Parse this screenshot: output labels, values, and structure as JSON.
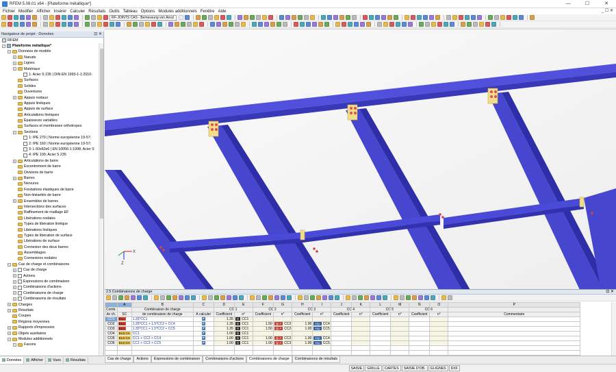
{
  "window": {
    "title": "RFEM 5.08.01 x64 - [Plateforme métallique*]",
    "min": "—",
    "max": "☐",
    "close": "✕"
  },
  "menu": {
    "items": [
      "Fichier",
      "Modifier",
      "Afficher",
      "Insérer",
      "Calculer",
      "Résultats",
      "Outils",
      "Tableau",
      "Options",
      "Modules additionnels",
      "Fenêtre",
      "Aide"
    ],
    "right": "_ ☐ ✕"
  },
  "toolbar": {
    "module_select": "RF-JOINTS CAS - Bemessung von Anscl",
    "arrow": "▾"
  },
  "navigator": {
    "title": "Navigateur de projet - Données",
    "controls": "⊡ ✕",
    "root": "RFEM",
    "tree": [
      {
        "label": "Plateforme métallique*",
        "level": 0,
        "exp": "−",
        "bold": true,
        "icon": "model"
      },
      {
        "label": "Données de modèle",
        "level": 1,
        "exp": "−",
        "icon": "folder"
      },
      {
        "label": "Nœuds",
        "level": 2,
        "exp": "+",
        "icon": "folder"
      },
      {
        "label": "Lignes",
        "level": 2,
        "exp": "+",
        "icon": "folder"
      },
      {
        "label": "Matériaux",
        "level": 2,
        "exp": "−",
        "icon": "folder"
      },
      {
        "label": "1: Acier S 235 | DIN EN 1993-1-1:2010-",
        "level": 3,
        "exp": "",
        "icon": "item"
      },
      {
        "label": "Surfaces",
        "level": 2,
        "exp": "",
        "icon": "folder"
      },
      {
        "label": "Solides",
        "level": 2,
        "exp": "",
        "icon": "folder"
      },
      {
        "label": "Ouvertures",
        "level": 2,
        "exp": "",
        "icon": "folder"
      },
      {
        "label": "Appuis nodaux",
        "level": 2,
        "exp": "+",
        "icon": "folder"
      },
      {
        "label": "Appuis linéiques",
        "level": 2,
        "exp": "",
        "icon": "folder"
      },
      {
        "label": "Appuis de surface",
        "level": 2,
        "exp": "",
        "icon": "folder"
      },
      {
        "label": "Articulations linéiques",
        "level": 2,
        "exp": "",
        "icon": "folder"
      },
      {
        "label": "Épaisseurs variables",
        "level": 2,
        "exp": "",
        "icon": "folder"
      },
      {
        "label": "Surfaces et membranes orthotropes",
        "level": 2,
        "exp": "",
        "icon": "folder"
      },
      {
        "label": "Sections",
        "level": 2,
        "exp": "−",
        "icon": "folder"
      },
      {
        "label": "1: IPE 270 | Norme européenne 19-57;",
        "level": 3,
        "exp": "",
        "icon": "item"
      },
      {
        "label": "2: IPE 160 | Norme européenne 19-57;",
        "level": 3,
        "exp": "",
        "icon": "item"
      },
      {
        "label": "3: L 60x60x6 | EN 10056-1:1998; Acier S",
        "level": 3,
        "exp": "",
        "icon": "item"
      },
      {
        "label": "4: IPE 100; Acier S 235",
        "level": 3,
        "exp": "",
        "icon": "item"
      },
      {
        "label": "Articulations de barre",
        "level": 2,
        "exp": "+",
        "icon": "folder"
      },
      {
        "label": "Excentrement de barre",
        "level": 2,
        "exp": "",
        "icon": "folder"
      },
      {
        "label": "Divisions de barre",
        "level": 2,
        "exp": "",
        "icon": "folder"
      },
      {
        "label": "Barres",
        "level": 2,
        "exp": "+",
        "icon": "folder"
      },
      {
        "label": "Nervures",
        "level": 2,
        "exp": "",
        "icon": "folder"
      },
      {
        "label": "Fondations élastiques de barre",
        "level": 2,
        "exp": "",
        "icon": "folder"
      },
      {
        "label": "Non-linéarités de barre",
        "level": 2,
        "exp": "",
        "icon": "folder"
      },
      {
        "label": "Ensembles de barres",
        "level": 2,
        "exp": "+",
        "icon": "folder"
      },
      {
        "label": "Intersections des surfaces",
        "level": 2,
        "exp": "",
        "icon": "folder"
      },
      {
        "label": "Raffinement de maillage EF",
        "level": 2,
        "exp": "",
        "icon": "folder"
      },
      {
        "label": "Libérations nodales",
        "level": 2,
        "exp": "",
        "icon": "folder"
      },
      {
        "label": "Types de libération linéique",
        "level": 2,
        "exp": "",
        "icon": "folder"
      },
      {
        "label": "Libérations linéiques",
        "level": 2,
        "exp": "",
        "icon": "folder"
      },
      {
        "label": "Types de libération de surface",
        "level": 2,
        "exp": "",
        "icon": "folder"
      },
      {
        "label": "Libérations de surface",
        "level": 2,
        "exp": "",
        "icon": "folder"
      },
      {
        "label": "Connexion des deux barres",
        "level": 2,
        "exp": "",
        "icon": "folder"
      },
      {
        "label": "Assemblages",
        "level": 2,
        "exp": "",
        "icon": "folder"
      },
      {
        "label": "Connexions nodales",
        "level": 2,
        "exp": "",
        "icon": "folder"
      },
      {
        "label": "Cas de charge et combinaisons",
        "level": 1,
        "exp": "−",
        "icon": "folder"
      },
      {
        "label": "Cas de charge",
        "level": 2,
        "exp": "+",
        "icon": "item"
      },
      {
        "label": "Actions",
        "level": 2,
        "exp": "+",
        "icon": "item"
      },
      {
        "label": "Expressions de combinaison",
        "level": 2,
        "exp": "+",
        "icon": "item"
      },
      {
        "label": "Combinaisons d'actions",
        "level": 2,
        "exp": "+",
        "icon": "item"
      },
      {
        "label": "Combinaisons de charge",
        "level": 2,
        "exp": "+",
        "icon": "item"
      },
      {
        "label": "Combinaisons de résultats",
        "level": 2,
        "exp": "+",
        "icon": "item"
      },
      {
        "label": "Charges",
        "level": 1,
        "exp": "+",
        "icon": "folder"
      },
      {
        "label": "Résultats",
        "level": 1,
        "exp": "+",
        "icon": "folder"
      },
      {
        "label": "Coupes",
        "level": 1,
        "exp": "",
        "icon": "folder"
      },
      {
        "label": "Régions moyennes",
        "level": 1,
        "exp": "",
        "icon": "folder"
      },
      {
        "label": "Rapports d'impression",
        "level": 1,
        "exp": "+",
        "icon": "folder"
      },
      {
        "label": "Objets auxiliaires",
        "level": 1,
        "exp": "+",
        "icon": "folder"
      },
      {
        "label": "Modules additionnels",
        "level": 1,
        "exp": "−",
        "icon": "folder"
      },
      {
        "label": "Favoris",
        "level": 2,
        "exp": "−",
        "icon": "folder"
      }
    ],
    "tabs": [
      "Données",
      "Afficher",
      "Vues",
      "Résultats"
    ]
  },
  "table": {
    "title": "2.5 Combinaisons de charge",
    "controls": "⊡ ✕",
    "col_letters": [
      "A",
      "B",
      "C",
      "D",
      "E",
      "F",
      "G",
      "H",
      "I",
      "J",
      "K",
      "L",
      "M",
      "N",
      "O",
      "P"
    ],
    "group_headers": {
      "comb": "Comb.",
      "b": "Combinaison de charge",
      "cc1": "CC 1",
      "cc2": "CC 2",
      "cc3": "CC 3",
      "cc4": "CC 4",
      "cc5": "CC 5",
      "cc6": "CC 6"
    },
    "sub_headers": {
      "comb": "de ch.",
      "sc": "SC",
      "b": "de combinaison de charge",
      "c": "À calculer",
      "coef": "Coefficient",
      "n": "n°",
      "comment": "Commentaire"
    },
    "rows": [
      {
        "id": "CO1",
        "sc": "ELU",
        "sc_color": "#d84a3a",
        "desc": "1.35*CC1",
        "cc1_coef": "1.35",
        "cc1_tag": "G",
        "cc1_n": "CC1",
        "cc2_coef": "",
        "cc2_tag": "",
        "cc2_n": "",
        "cc3_coef": "",
        "cc3_tag": "",
        "cc3_n": "",
        "selected": true
      },
      {
        "id": "CO2",
        "sc": "ELU",
        "sc_color": "#d84a3a",
        "desc": "1.35*CC1 + 1.5*CC2 + CC4",
        "cc1_coef": "1.35",
        "cc1_tag": "G",
        "cc1_n": "CC1",
        "cc2_coef": "1.50",
        "cc2_tag": "Qi A",
        "cc2_n": "CC2",
        "cc3_coef": "1.00",
        "cc3_tag": "Imp",
        "cc3_n": "CC4",
        "selected": false
      },
      {
        "id": "CO3",
        "sc": "ELU",
        "sc_color": "#d84a3a",
        "desc": "1.35*CC1 + 1.5*CC2 + CC5",
        "cc1_coef": "1.35",
        "cc1_tag": "G",
        "cc1_n": "CC1",
        "cc2_coef": "1.50",
        "cc2_tag": "Qi A",
        "cc2_n": "CC2",
        "cc3_coef": "1.00",
        "cc3_tag": "Imp",
        "cc3_n": "CC5",
        "selected": false
      },
      {
        "id": "CO4",
        "sc": "ELS CA",
        "sc_color": "#e8c44a",
        "desc": "CC1",
        "cc1_coef": "1.00",
        "cc1_tag": "G",
        "cc1_n": "CC1",
        "cc2_coef": "",
        "cc2_tag": "",
        "cc2_n": "",
        "cc3_coef": "",
        "cc3_tag": "",
        "cc3_n": "",
        "selected": false
      },
      {
        "id": "CO5",
        "sc": "ELS CA",
        "sc_color": "#e8c44a",
        "desc": "CC1 + CC2 + CC4",
        "cc1_coef": "1.00",
        "cc1_tag": "G",
        "cc1_n": "CC1",
        "cc2_coef": "1.00",
        "cc2_tag": "Qi A",
        "cc2_n": "CC2",
        "cc3_coef": "1.00",
        "cc3_tag": "Imp",
        "cc3_n": "CC4",
        "selected": false
      },
      {
        "id": "CO6",
        "sc": "ELS CA",
        "sc_color": "#e8c44a",
        "desc": "CC1 + CC3 + CC5",
        "cc1_coef": "1.00",
        "cc1_tag": "G",
        "cc1_n": "CC1",
        "cc2_coef": "1.00",
        "cc2_tag": "Qi A",
        "cc2_n": "CC3",
        "cc3_coef": "1.00",
        "cc3_tag": "Imp",
        "cc3_n": "CC5",
        "selected": false
      }
    ],
    "sheet_tabs": [
      "Cas de charge",
      "Actions",
      "Expressions de combinaison",
      "Combinaisons d'actions",
      "Combinaisons de charge",
      "Combinaisons de résultats"
    ],
    "active_tab": 4
  },
  "statusbar": {
    "buttons": [
      "SAISIE",
      "GRILLE",
      "CARTES",
      "SAISIE D'OB.",
      "GLIGNES",
      "DXF"
    ]
  },
  "viewport": {
    "axis_x": "X",
    "axis_z": "Z",
    "beam_color": "#4a4ad8",
    "plate_color": "#f2dd8a"
  }
}
